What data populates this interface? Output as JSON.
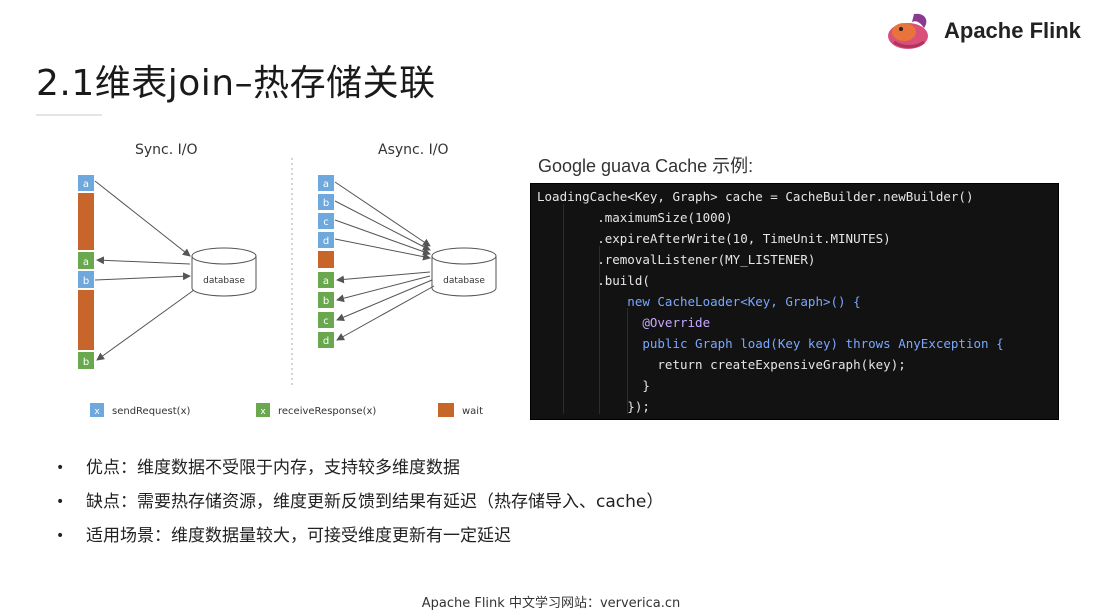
{
  "brand": {
    "logo_text": "Apache Flink",
    "logo_icon": "squirrel-logo-icon"
  },
  "slide": {
    "title": "2.1维表join–热存储关联"
  },
  "diagram": {
    "sync_title": "Sync. I/O",
    "async_title": "Async. I/O",
    "database_label": "database",
    "sync_blocks": [
      "a",
      "",
      "a",
      "b",
      "",
      "b"
    ],
    "async_blocks": [
      "a",
      "b",
      "c",
      "d",
      "",
      "a",
      "b",
      "c",
      "d"
    ],
    "legend": {
      "send_key": "x",
      "send_label": "sendRequest(x)",
      "receive_key": "x",
      "receive_label": "receiveResponse(x)",
      "wait_label": "wait"
    },
    "colors": {
      "send": "#6fa8dc",
      "receive": "#6aa84f",
      "wait": "#c8652a"
    }
  },
  "cache_example": {
    "label": "Google guava Cache 示例:",
    "code_lines": [
      "LoadingCache<Key, Graph> cache = CacheBuilder.newBuilder()",
      "        .maximumSize(1000)",
      "        .expireAfterWrite(10, TimeUnit.MINUTES)",
      "        .removalListener(MY_LISTENER)",
      "        .build(",
      "            new CacheLoader<Key, Graph>() {",
      "              @Override",
      "              public Graph load(Key key) throws AnyException {",
      "                return createExpensiveGraph(key);",
      "              }",
      "            });"
    ]
  },
  "bullets": [
    "优点：维度数据不受限于内存，支持较多维度数据",
    "缺点：需要热存储资源，维度更新反馈到结果有延迟（热存储导入、cache）",
    "适用场景：维度数据量较大，可接受维度更新有一定延迟"
  ],
  "bullet_symbol": "•",
  "footer": "Apache Flink 中文学习网站：ververica.cn"
}
